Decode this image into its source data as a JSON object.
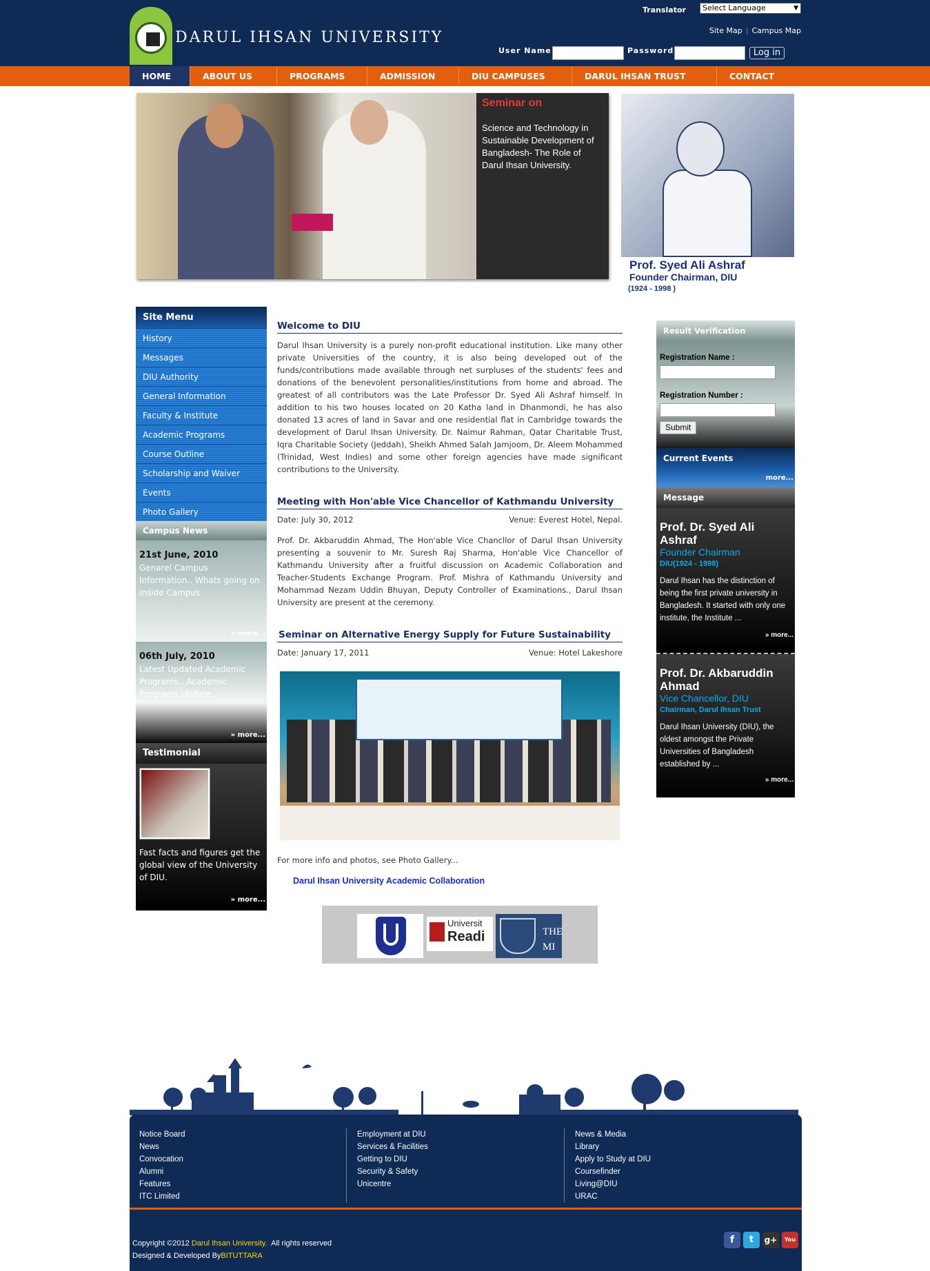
{
  "header": {
    "site_title": "DARUL IHSAN UNIVERSITY",
    "translator_label": "Translator",
    "language_select": "Select Language",
    "site_map": "Site Map",
    "campus_map": "Campus Map",
    "username_label": "User Name",
    "password_label": "Password",
    "login_button": "Log in"
  },
  "nav": {
    "items": [
      "HOME",
      "ABOUT US",
      "PROGRAMS",
      "ADMISSION",
      "DIU CAMPUSES",
      "DARUL IHSAN TRUST",
      "CONTACT"
    ]
  },
  "hero": {
    "title": "Seminar on",
    "description": "Science and Technology in Sustainable Development of Bangladesh- The Role of Darul Ihsan University."
  },
  "founder": {
    "name": "Prof. Syed Ali Ashraf",
    "title": "Founder Chairman, DIU",
    "years": "(1924 - 1998 )"
  },
  "sidebar": {
    "heading": "Site Menu",
    "items": [
      "History",
      "Messages",
      "DIU Authority",
      "General Information",
      "Faculty & Institute",
      "Academic Programs",
      "Course Outline",
      "Scholarship and Waiver",
      "Events",
      "Photo Gallery"
    ]
  },
  "campus_news": {
    "heading": "Campus News",
    "items": [
      {
        "date": "21st June, 2010",
        "text": "Genarel Campus Information.. Whats going on inside Campus",
        "more": "» more..."
      },
      {
        "date": "06th July, 2010",
        "text": "Latest Updated Academic Programs.. Academic Programs Update",
        "more": "» more..."
      }
    ]
  },
  "testimonial": {
    "heading": "Testimonial",
    "text": "Fast facts and figures get the global view of the University of DIU.",
    "more": "» more..."
  },
  "main": {
    "welcome": {
      "title": "Welcome to DIU",
      "body": "Darul Ihsan University is a purely non-profit educational institution. Like many other private Universities of the country, it is also being developed out of the funds/contributions made available through net surpluses of the students' fees and donations of the benevolent personalities/institutions from home and abroad. The greatest of all contributors was the Late Professor Dr. Syed Ali Ashraf himself. In addition to his two houses located on 20 Katha land in Dhanmondi, he has also donated 13 acres of land in Savar and one residential flat in Cambridge towards the development of Darul Ihsan University. Dr. Naimur Rahman, Qatar Charitable Trust, Iqra Charitable Society (Jeddah), Sheikh Ahmed Salah Jamjoom, Dr. Aleem Mohammed (Trinidad, West Indies) and some other foreign agencies have made significant contributions to the University."
    },
    "meeting": {
      "title": "Meeting with Hon'able Vice Chancellor of Kathmandu University",
      "date": "Date: July 30, 2012",
      "venue": "Venue: Everest Hotel, Nepal.",
      "body": "Prof. Dr. Akbaruddin Ahmad, The Hon'able Vice Chancllor of Darul Ihsan University presenting a souvenir to Mr. Suresh Raj Sharma, Hon'able Vice Chancellor of Kathmandu University after a fruitful discussion on Academic Collaboration and Teacher-Students Exchange Program. Prof. Mishra of Kathmandu University and Mohammad Nezam Uddin Bhuyan, Deputy Controller of Examinations., Darul Ihsan University are present at the ceremony."
    },
    "seminar": {
      "title": "Seminar on Alternative Energy Supply for Future Sustainability",
      "date": "Date: January 17, 2011",
      "venue": "Venue: Hotel Lakeshore"
    },
    "more_info": "For more info and photos, see Photo Gallery...",
    "collab_title": "Darul Ihsan University Academic Collaboration",
    "collab_logos": [
      "Universit",
      "Readi",
      "THE",
      "MI"
    ]
  },
  "right": {
    "result_verification": "Result Verification",
    "reg_name_label": "Registration Name :",
    "reg_number_label": "Registration Number :",
    "submit": "Submit",
    "current_events": "Current Events",
    "more": "more...",
    "message_heading": "Message",
    "messages": [
      {
        "name": "Prof. Dr. Syed Ali Ashraf",
        "role": "Founder Chairman",
        "sub": "DIU(1924 - 1998)",
        "text": "Darul Ihsan has the distinction of being the first private university in Bangladesh. It started with only one institute, the Institute ...",
        "more": "» more..."
      },
      {
        "name": "Prof. Dr. Akbaruddin Ahmad",
        "role": "Vice Chancellor, DIU",
        "sub": "Chairman, Darul Ihsan Trust",
        "text": "Darul Ihsan University (DIU), the oldest amongst the Private Universities of Bangladesh established by ...",
        "more": "» more..."
      }
    ]
  },
  "footer": {
    "col1": [
      "Notice Board",
      "News",
      "Convocation",
      "Alumni",
      "Features",
      "ITC Limited"
    ],
    "col2": [
      "Employment at DIU",
      "Services & Facilities",
      "Getting to DIU",
      "Security & Safety",
      "Unicentre"
    ],
    "col3": [
      "News & Media",
      "Library",
      "Apply to Study at DIU",
      "Coursefinder",
      "Living@DIU",
      "URAC"
    ],
    "copyright_prefix": "Copyright ©2012",
    "copyright_name": "Darul Ihsan University.",
    "copyright_suffix": "All rights reserved",
    "designed_prefix": "Designed & Developed By",
    "designed_by": "BITUTTARA",
    "social": [
      "f",
      "t",
      "g+",
      "You"
    ]
  },
  "colors": {
    "navy": "#0e2a55",
    "orange": "#e35f0d",
    "accent_blue": "#0fa9e6",
    "seminar_red": "#e53935"
  }
}
